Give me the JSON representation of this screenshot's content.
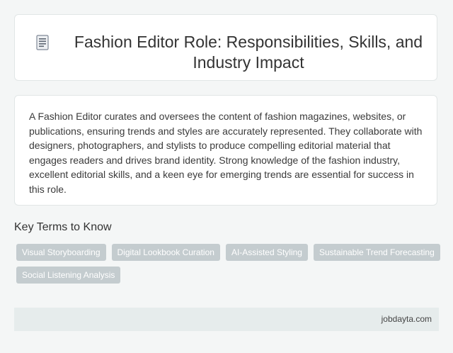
{
  "header": {
    "title": "Fashion Editor Role: Responsibilities, Skills, and Industry Impact",
    "icon": "document-icon"
  },
  "description": {
    "text": "A Fashion Editor curates and oversees the content of fashion magazines, websites, or publications, ensuring trends and styles are accurately represented. They collaborate with designers, photographers, and stylists to produce compelling editorial material that engages readers and drives brand identity. Strong knowledge of the fashion industry, excellent editorial skills, and a keen eye for emerging trends are essential for success in this role."
  },
  "key_terms": {
    "heading": "Key Terms to Know",
    "tags": [
      "Visual Storyboarding",
      "Digital Lookbook Curation",
      "AI-Assisted Styling",
      "Sustainable Trend Forecasting",
      "Social Listening Analysis"
    ]
  },
  "footer": {
    "credit": "jobdayta.com"
  },
  "colors": {
    "background": "#f4f6f6",
    "tag_background": "#c4cccf",
    "footer_background": "#e6ecec"
  }
}
